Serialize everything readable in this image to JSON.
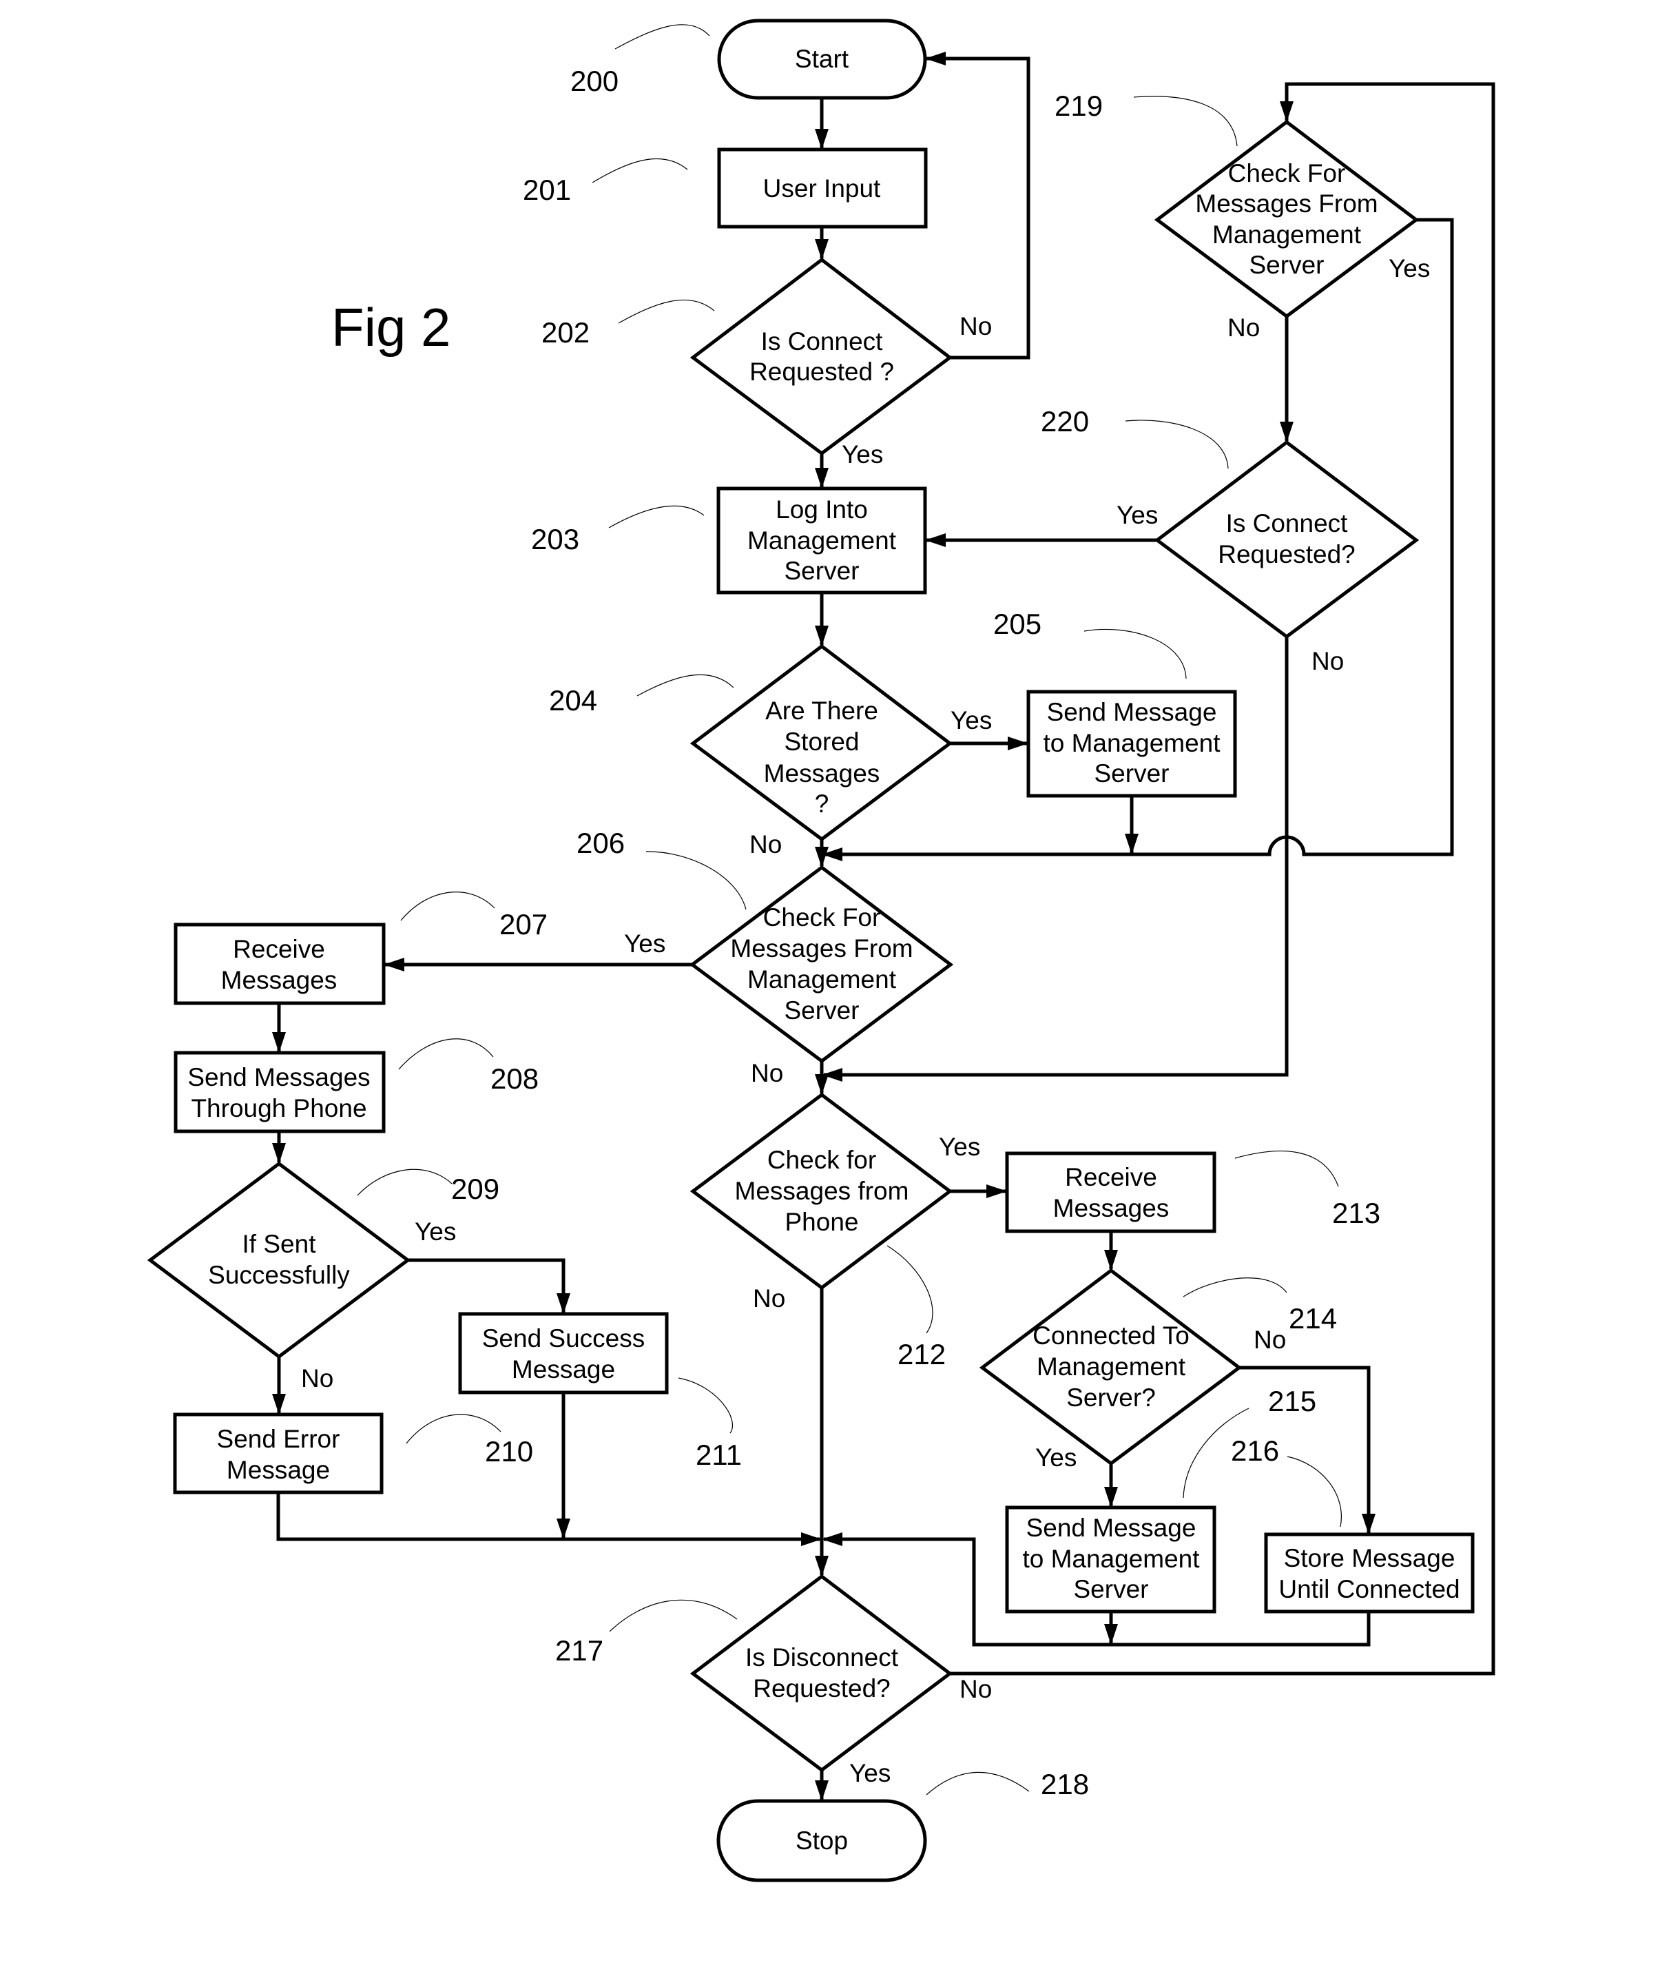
{
  "figure": {
    "title": "Fig 2"
  },
  "nodes": {
    "n200": {
      "ref": "200",
      "type": "terminal",
      "lines": [
        "Start"
      ]
    },
    "n201": {
      "ref": "201",
      "type": "process",
      "lines": [
        "User Input"
      ]
    },
    "n202": {
      "ref": "202",
      "type": "decision",
      "lines": [
        "Is Connect",
        "Requested ?"
      ]
    },
    "n203": {
      "ref": "203",
      "type": "process",
      "lines": [
        "Log Into",
        "Management",
        "Server"
      ]
    },
    "n204": {
      "ref": "204",
      "type": "decision",
      "lines": [
        "Are There",
        "Stored",
        "Messages",
        "?"
      ]
    },
    "n205": {
      "ref": "205",
      "type": "process",
      "lines": [
        "Send Message",
        "to Management",
        "Server"
      ]
    },
    "n206": {
      "ref": "206",
      "type": "decision",
      "lines": [
        "Check For",
        "Messages From",
        "Management",
        "Server"
      ]
    },
    "n207": {
      "ref": "207",
      "type": "process",
      "lines": [
        "Receive",
        "Messages"
      ]
    },
    "n208": {
      "ref": "208",
      "type": "process",
      "lines": [
        "Send Messages",
        "Through Phone"
      ]
    },
    "n209": {
      "ref": "209",
      "type": "decision",
      "lines": [
        "If Sent",
        "Successfully"
      ]
    },
    "n210": {
      "ref": "210",
      "type": "process",
      "lines": [
        "Send Error",
        "Message"
      ]
    },
    "n211": {
      "ref": "211",
      "type": "process",
      "lines": [
        "Send Success",
        "Message"
      ]
    },
    "n212": {
      "ref": "212",
      "type": "decision",
      "lines": [
        "Check for",
        "Messages from",
        "Phone"
      ]
    },
    "n213": {
      "ref": "213",
      "type": "process",
      "lines": [
        "Receive",
        "Messages"
      ]
    },
    "n214": {
      "ref": "214",
      "type": "decision",
      "lines": [
        "Connected To",
        "Management",
        "Server?"
      ]
    },
    "n215": {
      "ref": "215",
      "type": "process",
      "lines": [
        "Send Message",
        "to Management",
        "Server"
      ]
    },
    "n216": {
      "ref": "216",
      "type": "process",
      "lines": [
        "Store Message",
        "Until Connected"
      ]
    },
    "n217": {
      "ref": "217",
      "type": "decision",
      "lines": [
        "Is Disconnect",
        "Requested?"
      ]
    },
    "n218": {
      "ref": "218",
      "type": "terminal",
      "lines": [
        "Stop"
      ]
    },
    "n219": {
      "ref": "219",
      "type": "decision",
      "lines": [
        "Check For",
        "Messages From",
        "Management",
        "Server"
      ]
    },
    "n220": {
      "ref": "220",
      "type": "decision",
      "lines": [
        "Is Connect",
        "Requested?"
      ]
    }
  },
  "edges": [
    {
      "from": "200",
      "to": "201",
      "label": ""
    },
    {
      "from": "201",
      "to": "202",
      "label": ""
    },
    {
      "from": "202",
      "to": "200",
      "label": "No"
    },
    {
      "from": "202",
      "to": "203",
      "label": "Yes"
    },
    {
      "from": "203",
      "to": "204",
      "label": ""
    },
    {
      "from": "204",
      "to": "205",
      "label": "Yes"
    },
    {
      "from": "204",
      "to": "206",
      "label": "No"
    },
    {
      "from": "205",
      "to": "206",
      "label": ""
    },
    {
      "from": "206",
      "to": "207",
      "label": "Yes"
    },
    {
      "from": "206",
      "to": "212",
      "label": "No"
    },
    {
      "from": "207",
      "to": "208",
      "label": ""
    },
    {
      "from": "208",
      "to": "209",
      "label": ""
    },
    {
      "from": "209",
      "to": "211",
      "label": "Yes"
    },
    {
      "from": "209",
      "to": "210",
      "label": "No"
    },
    {
      "from": "210",
      "to": "217",
      "label": ""
    },
    {
      "from": "211",
      "to": "217",
      "label": ""
    },
    {
      "from": "212",
      "to": "213",
      "label": "Yes"
    },
    {
      "from": "212",
      "to": "217",
      "label": "No"
    },
    {
      "from": "213",
      "to": "214",
      "label": ""
    },
    {
      "from": "214",
      "to": "215",
      "label": "Yes"
    },
    {
      "from": "214",
      "to": "216",
      "label": "No"
    },
    {
      "from": "215",
      "to": "217",
      "label": ""
    },
    {
      "from": "216",
      "to": "217",
      "label": ""
    },
    {
      "from": "217",
      "to": "218",
      "label": "Yes"
    },
    {
      "from": "217",
      "to": "219",
      "label": "No"
    },
    {
      "from": "219",
      "to": "206",
      "label": "Yes"
    },
    {
      "from": "219",
      "to": "220",
      "label": "No"
    },
    {
      "from": "220",
      "to": "203",
      "label": "Yes"
    },
    {
      "from": "220",
      "to": "212",
      "label": "No"
    }
  ],
  "edge_labels": {
    "l202_no": "No",
    "l202_yes": "Yes",
    "l204_yes": "Yes",
    "l204_no": "No",
    "l206_yes": "Yes",
    "l206_no": "No",
    "l209_yes": "Yes",
    "l209_no": "No",
    "l212_yes": "Yes",
    "l212_no": "No",
    "l214_no": "No",
    "l214_yes": "Yes",
    "l217_no": "No",
    "l217_yes": "Yes",
    "l219_yes": "Yes",
    "l219_no": "No",
    "l220_yes": "Yes",
    "l220_no": "No"
  }
}
